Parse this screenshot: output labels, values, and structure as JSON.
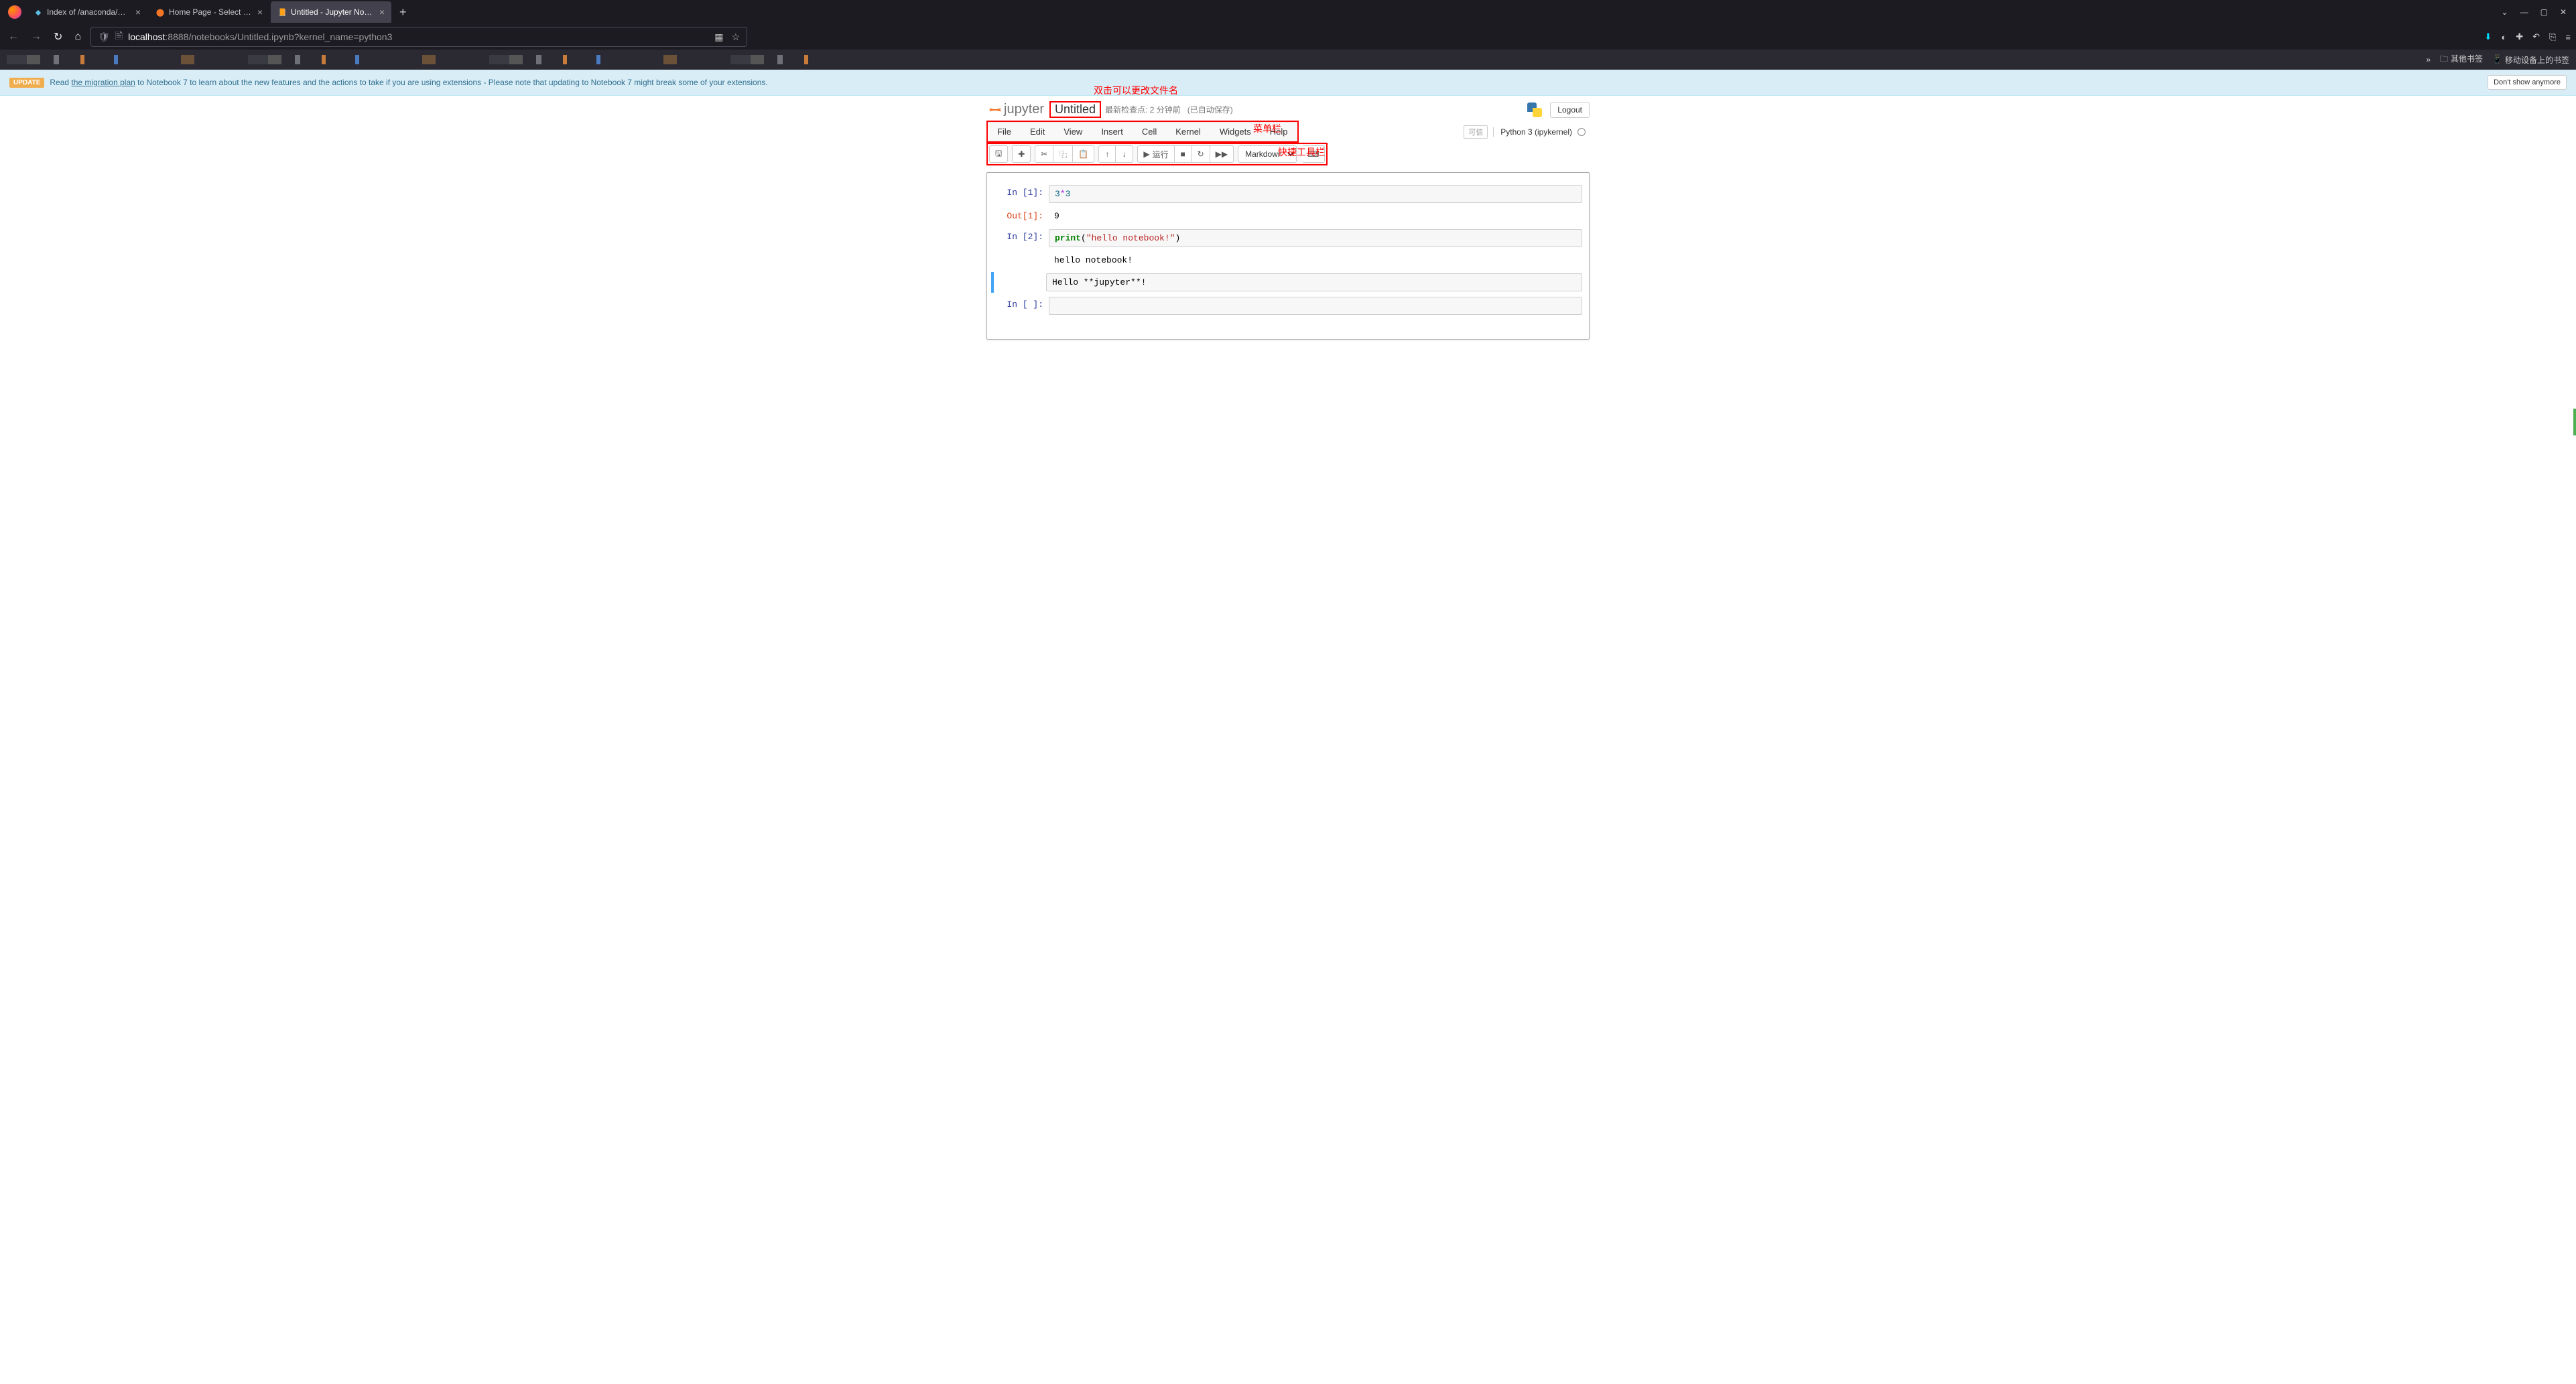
{
  "browser": {
    "tabs": [
      {
        "title": "Index of /anaconda/archive/",
        "active": false
      },
      {
        "title": "Home Page - Select or create",
        "active": false
      },
      {
        "title": "Untitled - Jupyter Notebook",
        "active": true
      }
    ],
    "url_host": "localhost",
    "url_port": ":8888",
    "url_path": "/notebooks/Untitled.ipynb?kernel_name=python3",
    "bookmarks_other": "其他书签",
    "bookmarks_mobile": "移动设备上的书签"
  },
  "banner": {
    "badge": "UPDATE",
    "pre": "Read ",
    "link": "the migration plan",
    "post": " to Notebook 7 to learn about the new features and the actions to take if you are using extensions - Please note that updating to Notebook 7 might break some of your extensions.",
    "dismiss": "Don't show anymore"
  },
  "header": {
    "logo": "jupyter",
    "title": "Untitled",
    "checkpoint": "最新检查点: 2 分钟前",
    "autosave": "(已自动保存)",
    "logout": "Logout"
  },
  "annotations": {
    "filename": "双击可以更改文件名",
    "menubar": "菜单栏",
    "toolbar": "快捷工具栏"
  },
  "menu": {
    "file": "File",
    "edit": "Edit",
    "view": "View",
    "insert": "Insert",
    "cell": "Cell",
    "kernel": "Kernel",
    "widgets": "Widgets",
    "help": "Help",
    "trusted": "可信",
    "kernel_name": "Python 3 (ipykernel)"
  },
  "toolbar": {
    "run": "运行",
    "cell_type": "Markdown"
  },
  "cells": {
    "c1_prompt": "In [1]:",
    "c1_code_a": "3",
    "c1_code_op": "*",
    "c1_code_b": "3",
    "c1_out_prompt": "Out[1]:",
    "c1_out": "9",
    "c2_prompt": "In [2]:",
    "c2_kw": "print",
    "c2_paren_o": "(",
    "c2_str": "\"hello notebook!\"",
    "c2_paren_c": ")",
    "c2_out": "hello notebook!",
    "c3_md": "Hello **jupyter**!",
    "c4_prompt": "In [ ]:"
  }
}
